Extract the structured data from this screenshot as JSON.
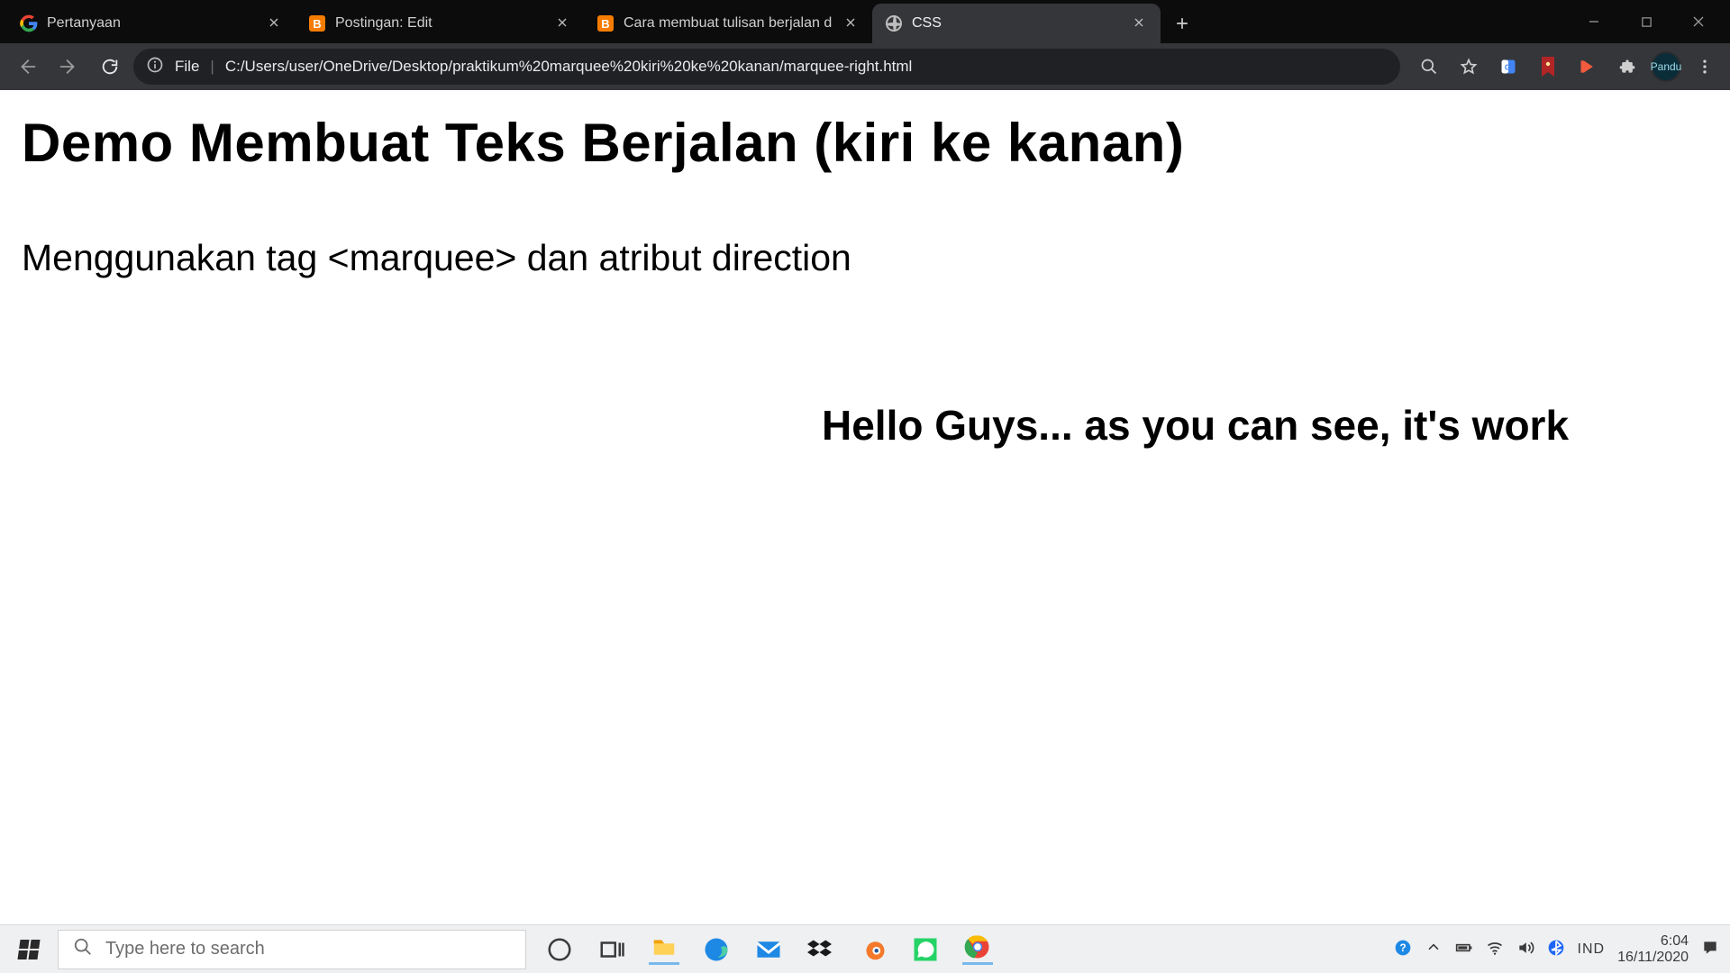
{
  "browser": {
    "tabs": [
      {
        "title": "Pertanyaan",
        "favicon": "google"
      },
      {
        "title": "Postingan: Edit",
        "favicon": "blogger"
      },
      {
        "title": "Cara membuat tulisan berjalan d",
        "favicon": "blogger"
      },
      {
        "title": "CSS",
        "favicon": "globe"
      }
    ],
    "active_tab_index": 3,
    "omnibox": {
      "prefix": "File",
      "path": "C:/Users/user/OneDrive/Desktop/praktikum%20marquee%20kiri%20ke%20kanan/marquee-right.html"
    },
    "profile_label": "Pandu"
  },
  "page": {
    "heading": "Demo Membuat Teks Berjalan (kiri ke kanan)",
    "subheading": "Menggunakan tag <marquee> dan atribut direction",
    "marquee_text": "Hello Guys... as you can see, it's work"
  },
  "taskbar": {
    "search_placeholder": "Type here to search",
    "language": "IND",
    "time": "6:04",
    "date": "16/11/2020"
  }
}
